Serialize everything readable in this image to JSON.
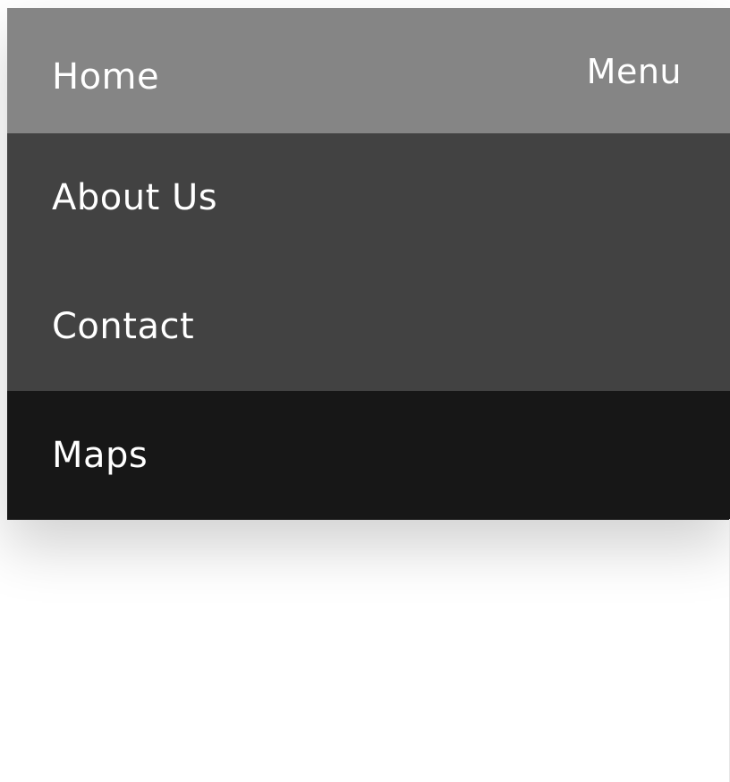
{
  "header": {
    "home_label": "Home",
    "menu_label": "Menu"
  },
  "menu": {
    "items": [
      {
        "label": "About Us"
      },
      {
        "label": "Contact"
      },
      {
        "label": "Maps"
      }
    ]
  },
  "colors": {
    "header_bg": "#858585",
    "item_bg": "#424242",
    "active_item_bg": "#171717",
    "text": "#ffffff"
  }
}
